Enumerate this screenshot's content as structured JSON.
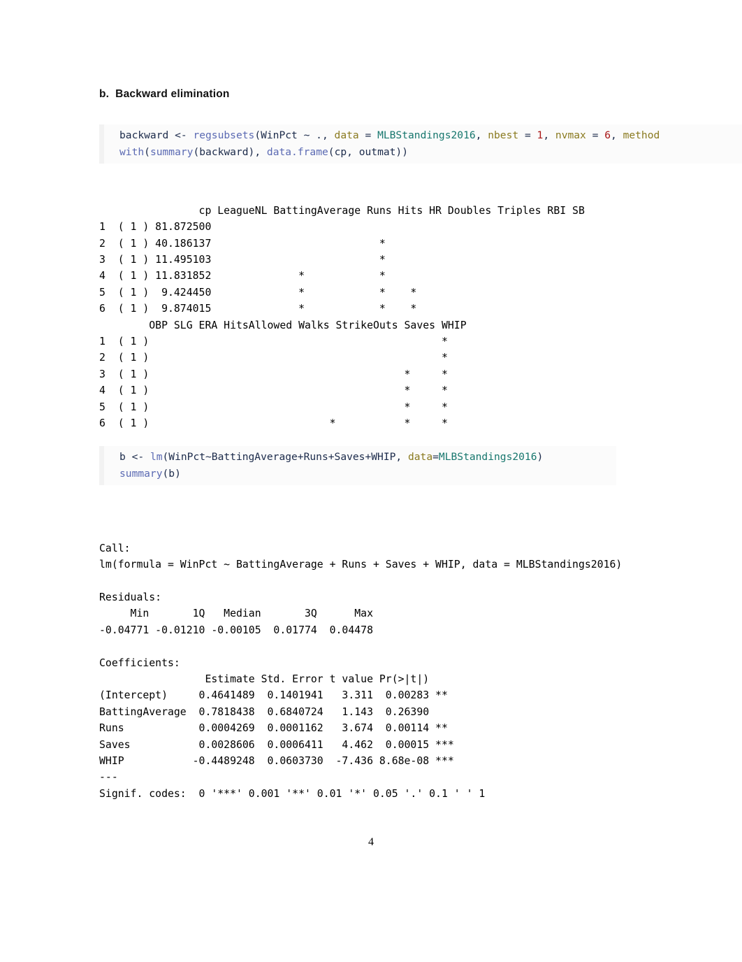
{
  "section": {
    "heading": "b.  Backward elimination"
  },
  "code_blocks": [
    {
      "id": "code-block-1",
      "lines": [
        [
          {
            "text": "backward <- ",
            "type": "plain"
          },
          {
            "text": "regsubsets",
            "type": "fn"
          },
          {
            "text": "(WinPct ~ ., ",
            "type": "plain"
          },
          {
            "text": "data",
            "type": "arg"
          },
          {
            "text": " = ",
            "type": "plain"
          },
          {
            "text": "MLBStandings2016",
            "type": "str"
          },
          {
            "text": ", ",
            "type": "plain"
          },
          {
            "text": "nbest",
            "type": "arg"
          },
          {
            "text": " = ",
            "type": "plain"
          },
          {
            "text": "1",
            "type": "num"
          },
          {
            "text": ", ",
            "type": "plain"
          },
          {
            "text": "nvmax",
            "type": "arg"
          },
          {
            "text": " = ",
            "type": "plain"
          },
          {
            "text": "6",
            "type": "num"
          },
          {
            "text": ", ",
            "type": "plain"
          },
          {
            "text": "method",
            "type": "arg"
          }
        ],
        [
          {
            "text": "with",
            "type": "fn"
          },
          {
            "text": "(",
            "type": "plain"
          },
          {
            "text": "summary",
            "type": "fn"
          },
          {
            "text": "(backward), ",
            "type": "plain"
          },
          {
            "text": "data.frame",
            "type": "fn"
          },
          {
            "text": "(cp, outmat))",
            "type": "plain"
          }
        ]
      ]
    },
    {
      "id": "code-block-2",
      "lines": [
        [
          {
            "text": "b <- ",
            "type": "plain"
          },
          {
            "text": "lm",
            "type": "fn"
          },
          {
            "text": "(WinPct~BattingAverage+Runs+Saves+WHIP, ",
            "type": "plain"
          },
          {
            "text": "data",
            "type": "arg"
          },
          {
            "text": "=",
            "type": "plain"
          },
          {
            "text": "MLBStandings2016",
            "type": "str"
          },
          {
            "text": ")",
            "type": "plain"
          }
        ],
        [
          {
            "text": "summary",
            "type": "fn"
          },
          {
            "text": "(b)",
            "type": "plain"
          }
        ]
      ]
    }
  ],
  "outputs": {
    "regsubsets": "                cp LeagueNL BattingAverage Runs Hits HR Doubles Triples RBI SB\n1  ( 1 ) 81.872500                                                            \n2  ( 1 ) 40.186137                           *                                \n3  ( 1 ) 11.495103                           *                                \n4  ( 1 ) 11.831852              *            *                                \n5  ( 1 )  9.424450              *            *    *                           \n6  ( 1 )  9.874015              *            *    *                           \n        OBP SLG ERA HitsAllowed Walks StrikeOuts Saves WHIP\n1  ( 1 )                                               *\n2  ( 1 )                                               *\n3  ( 1 )                                         *     *\n4  ( 1 )                                         *     *\n5  ( 1 )                                         *     *\n6  ( 1 )                             *           *     *",
    "summary": "Call:\nlm(formula = WinPct ~ BattingAverage + Runs + Saves + WHIP, data = MLBStandings2016)\n\nResiduals:\n     Min       1Q   Median       3Q      Max \n-0.04771 -0.01210 -0.00105  0.01774  0.04478 \n\nCoefficients:\n                 Estimate Std. Error t value Pr(>|t|)    \n(Intercept)     0.4641489  0.1401941   3.311  0.00283 ** \nBattingAverage  0.7818438  0.6840724   1.143  0.26390    \nRuns            0.0004269  0.0001162   3.674  0.00114 ** \nSaves           0.0028606  0.0006411   4.462  0.00015 ***\nWHIP           -0.4489248  0.0603730  -7.436 8.68e-08 ***\n---\nSignif. codes:  0 '***' 0.001 '**' 0.01 '*' 0.05 '.' 0.1 ' ' 1"
  },
  "footer": {
    "page_number": "4"
  },
  "tables": {
    "regsubsets_part1": {
      "columns": [
        "",
        "cp",
        "LeagueNL",
        "BattingAverage",
        "Runs",
        "Hits",
        "HR",
        "Doubles",
        "Triples",
        "RBI",
        "SB"
      ],
      "rows": [
        {
          "label": "1  ( 1 )",
          "cp": "81.872500",
          "selected": []
        },
        {
          "label": "2  ( 1 )",
          "cp": "40.186137",
          "selected": [
            "Runs"
          ]
        },
        {
          "label": "3  ( 1 )",
          "cp": "11.495103",
          "selected": [
            "Runs"
          ]
        },
        {
          "label": "4  ( 1 )",
          "cp": "11.831852",
          "selected": [
            "BattingAverage",
            "Runs"
          ]
        },
        {
          "label": "5  ( 1 )",
          "cp": "9.424450",
          "selected": [
            "BattingAverage",
            "Runs",
            "Hits"
          ]
        },
        {
          "label": "6  ( 1 )",
          "cp": "9.874015",
          "selected": [
            "BattingAverage",
            "Runs",
            "Hits"
          ]
        }
      ]
    },
    "regsubsets_part2": {
      "columns": [
        "",
        "OBP",
        "SLG",
        "ERA",
        "HitsAllowed",
        "Walks",
        "StrikeOuts",
        "Saves",
        "WHIP"
      ],
      "rows": [
        {
          "label": "1  ( 1 )",
          "selected": [
            "WHIP"
          ]
        },
        {
          "label": "2  ( 1 )",
          "selected": [
            "WHIP"
          ]
        },
        {
          "label": "3  ( 1 )",
          "selected": [
            "Saves",
            "WHIP"
          ]
        },
        {
          "label": "4  ( 1 )",
          "selected": [
            "Saves",
            "WHIP"
          ]
        },
        {
          "label": "5  ( 1 )",
          "selected": [
            "Saves",
            "WHIP"
          ]
        },
        {
          "label": "6  ( 1 )",
          "selected": [
            "Walks",
            "Saves",
            "WHIP"
          ]
        }
      ]
    },
    "residuals": {
      "columns": [
        "Min",
        "1Q",
        "Median",
        "3Q",
        "Max"
      ],
      "values": [
        "-0.04771",
        "-0.01210",
        "-0.00105",
        "0.01774",
        "0.04478"
      ]
    },
    "coefficients": {
      "columns": [
        "",
        "Estimate",
        "Std. Error",
        "t value",
        "Pr(>|t|)",
        ""
      ],
      "rows": [
        {
          "term": "(Intercept)",
          "estimate": "0.4641489",
          "std_error": "0.1401941",
          "t_value": "3.311",
          "p_value": "0.00283",
          "signif": "**"
        },
        {
          "term": "BattingAverage",
          "estimate": "0.7818438",
          "std_error": "0.6840724",
          "t_value": "1.143",
          "p_value": "0.26390",
          "signif": ""
        },
        {
          "term": "Runs",
          "estimate": "0.0004269",
          "std_error": "0.0001162",
          "t_value": "3.674",
          "p_value": "0.00114",
          "signif": "**"
        },
        {
          "term": "Saves",
          "estimate": "0.0028606",
          "std_error": "0.0006411",
          "t_value": "4.462",
          "p_value": "0.00015",
          "signif": "***"
        },
        {
          "term": "WHIP",
          "estimate": "-0.4489248",
          "std_error": "0.0603730",
          "t_value": "-7.436",
          "p_value": "8.68e-08",
          "signif": "***"
        }
      ],
      "signif_codes": "Signif. codes:  0 '***' 0.001 '**' 0.01 '*' 0.05 '.' 0.1 ' ' 1"
    }
  }
}
